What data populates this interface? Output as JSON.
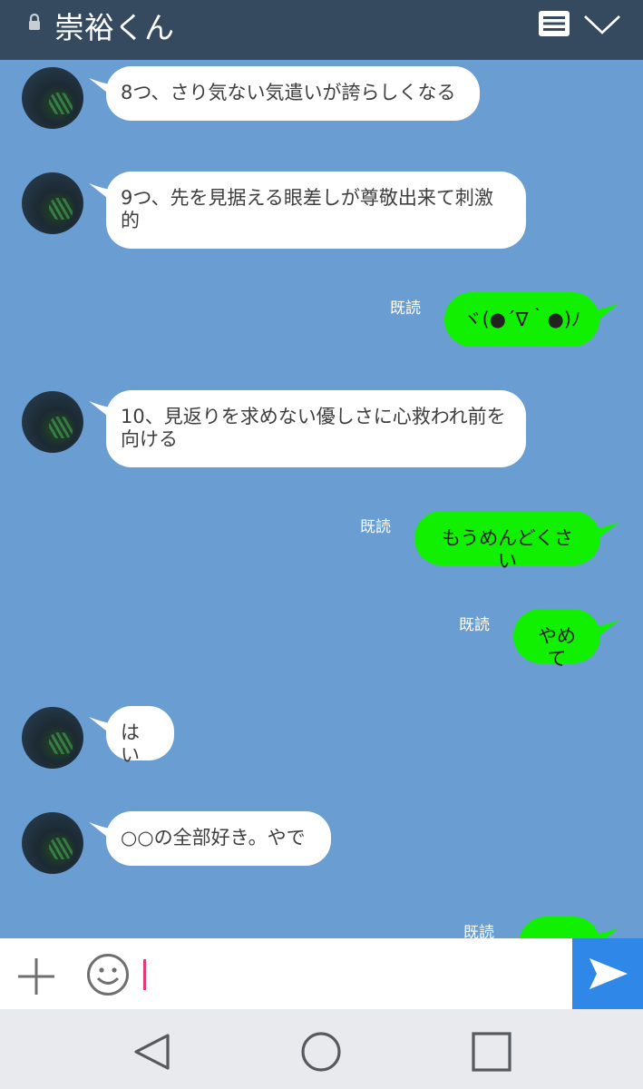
{
  "header": {
    "title": "崇裕くん",
    "lock_icon": "lock-icon",
    "menu_icon": "menu-icon",
    "expand_icon": "chevron-down-icon"
  },
  "messages": [
    {
      "side": "in",
      "text": "8つ、さり気ない気遣いが誇らしくなる"
    },
    {
      "side": "in",
      "text": "9つ、先を見据える眼差しが尊敬出来て刺激的"
    },
    {
      "side": "out",
      "text": "ヾ(●´∇｀●)ﾉ",
      "read": "既読"
    },
    {
      "side": "in",
      "text": "10、見返りを求めない優しさに心救われ前を向ける"
    },
    {
      "side": "out",
      "text": "もうめんどくさい",
      "read": "既読"
    },
    {
      "side": "out",
      "text": "やめて",
      "read": "既読"
    },
    {
      "side": "in",
      "text": "はい"
    },
    {
      "side": "in",
      "text": "○○の全部好き。やで"
    },
    {
      "side": "out",
      "text": "",
      "read": "既読"
    }
  ],
  "input": {
    "value": "",
    "add_icon": "plus-icon",
    "sticker_icon": "smiley-icon",
    "send_icon": "send-icon"
  },
  "colors": {
    "header": "#354a5f",
    "chat_background": "#6a9ed2",
    "outgoing_bubble": "#10f000",
    "incoming_bubble": "#ffffff",
    "send_button": "#2f87e8",
    "caret": "#e43b74"
  },
  "nav": {
    "back_icon": "back-triangle-icon",
    "home_icon": "home-circle-icon",
    "recent_icon": "recent-apps-square-icon"
  }
}
